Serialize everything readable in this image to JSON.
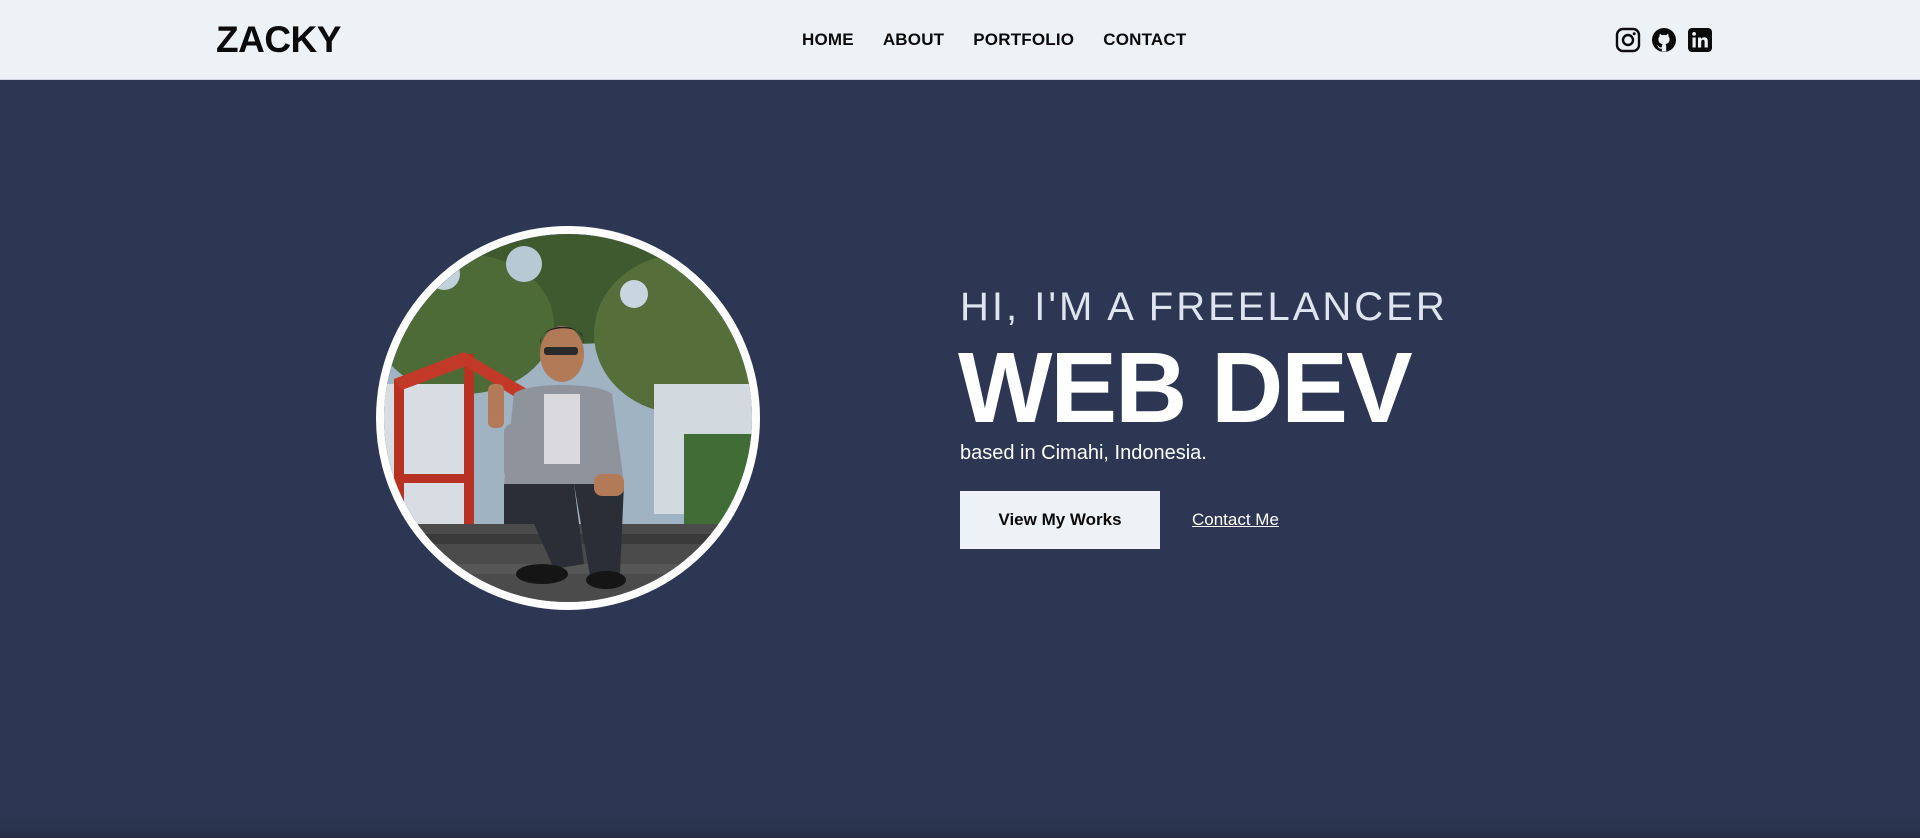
{
  "brand": {
    "logo": "ZACKY"
  },
  "nav": {
    "items": [
      {
        "label": "HOME"
      },
      {
        "label": "ABOUT"
      },
      {
        "label": "PORTFOLIO"
      },
      {
        "label": "CONTACT"
      }
    ]
  },
  "socials": [
    {
      "icon": "instagram-icon"
    },
    {
      "icon": "github-icon"
    },
    {
      "icon": "linkedin-icon"
    }
  ],
  "hero": {
    "subtitle": "HI, I'M A FREELANCER",
    "headline": "WEB DEV",
    "tagline": "based in Cimahi, Indonesia.",
    "primary_button": "View My Works",
    "secondary_link": "Contact Me"
  },
  "colors": {
    "navbar_bg": "#edf2f7",
    "hero_bg": "#2d3753",
    "text_dark": "#0b0b0b",
    "text_light": "#ffffff"
  }
}
